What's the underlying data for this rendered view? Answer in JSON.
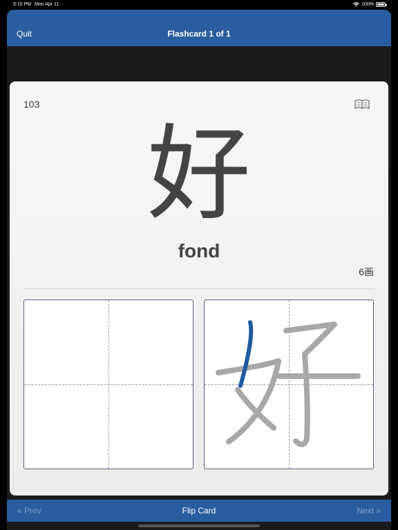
{
  "status": {
    "time": "5:15 PM",
    "date": "Mon Apr 11",
    "battery": "100%"
  },
  "nav": {
    "quit_label": "Quit",
    "title": "Flashcard 1 of 1"
  },
  "card": {
    "number": "103",
    "kanji": "好",
    "meaning": "fond",
    "stroke_count": "6画",
    "stroke_progress": {
      "drawn": 1,
      "total": 6
    }
  },
  "colors": {
    "bar": "#2a5d9f",
    "active_stroke": "#1f5aa0",
    "guide_stroke": "#a8a8a8"
  },
  "bottom": {
    "prev_label": "« Prev",
    "flip_label": "Flip Card",
    "next_label": "Next »"
  }
}
